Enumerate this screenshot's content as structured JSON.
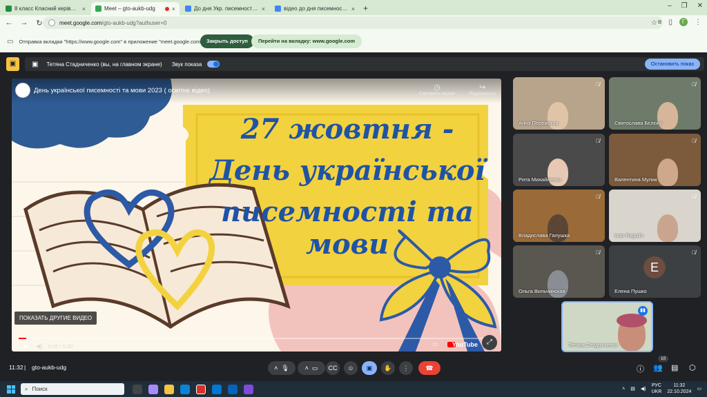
{
  "browser": {
    "tabs": [
      {
        "title": "8 класс Класний керівник: Ста...",
        "active": false,
        "color": "#1e8e3e"
      },
      {
        "title": "Meet – gto-aukb-udg",
        "active": true,
        "color": "#34a853"
      },
      {
        "title": "До дня Укр. писемності та мо...",
        "active": false,
        "color": "#4285f4"
      },
      {
        "title": "відео до дня писемності т...",
        "active": false,
        "color": "#4285f4"
      }
    ],
    "new_tab": "+",
    "url_host": "meet.google.com",
    "url_path": "/gto-aukb-udg?authuser=0",
    "profile_letter": "Г"
  },
  "share_bar": {
    "message": "Отправка вкладки \"https://www.google.com\" в приложение \"meet.google.com\"...",
    "stop_label": "Закрыть доступ",
    "goto_label": "Перейти на вкладку: www.google.com"
  },
  "presenting": {
    "presenter_label": "Тетяна Стадниченко (вы, на главном экране)",
    "audio_label": "Звук показа",
    "stop_label": "Остановить показ"
  },
  "video": {
    "title": "День української писемності та мови 2023 ( освітнє відео)",
    "watch_later": "Смотреть позже",
    "share": "Поделиться",
    "headline_1": "27 жовтня -",
    "headline_2": "День української",
    "headline_3": "писемності та мови",
    "more_videos": "ПОКАЗАТЬ ДРУГИЕ ВИДЕО",
    "time": "0:05 / 5:20",
    "progress": 0.016,
    "youtube": "YouTube"
  },
  "participants": [
    {
      "name": "Анна Пережогна",
      "bg": "#b8a48a",
      "face": "#e0c4a8"
    },
    {
      "name": "Святослава Бєлєкчі",
      "bg": "#6f7b6a",
      "face": "#d7b59a"
    },
    {
      "name": "Рита Михайленко",
      "bg": "#4a4a4a",
      "face": "#e7c8b3"
    },
    {
      "name": "Валентина Мулик",
      "bg": "#7c5a3c",
      "face": "#cfa88a"
    },
    {
      "name": "Владислава Галушка",
      "bg": "#9a6b38",
      "face": "#5b4636"
    },
    {
      "name": "Ivan Ragulin",
      "bg": "#d9d4cc",
      "face": "#c9a58f"
    },
    {
      "name": "Ольга Вильчинская",
      "bg": "#5a5750",
      "face": "#8b8d94"
    },
    {
      "name": "Елена Пушко",
      "bg": "#3c4043",
      "letter": "E"
    }
  ],
  "self": {
    "name": "Тетяна Стадниченко"
  },
  "bottom": {
    "clock": "11:32",
    "separator": "|",
    "meeting_code": "gto-aukb-udg",
    "people_count": "10"
  },
  "taskbar": {
    "search_placeholder": "Поиск",
    "lang_1": "РУС",
    "lang_2": "UKR",
    "time": "11:32",
    "date": "22.10.2024"
  }
}
